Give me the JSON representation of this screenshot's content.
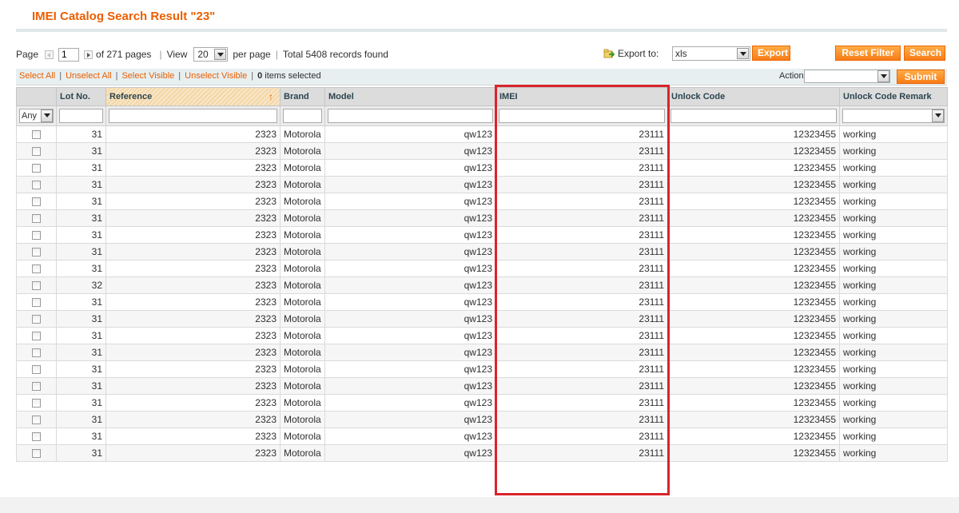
{
  "page": {
    "title": "IMEI Catalog Search Result  \"23\""
  },
  "pager": {
    "page_label": "Page",
    "current_page": "1",
    "of_pages": "of 271 pages",
    "view_label": "View",
    "per_page_value": "20",
    "per_page_label": "per page",
    "total_records": "Total 5408 records found",
    "export_label": "Export to:",
    "export_format": "xls",
    "export_button": "Export",
    "reset_filter_button": "Reset Filter",
    "search_button": "Search"
  },
  "massaction": {
    "select_all": "Select All",
    "unselect_all": "Unselect All",
    "select_visible": "Select Visible",
    "unselect_visible": "Unselect Visible",
    "selected_count": "0",
    "selected_suffix": "items selected",
    "actions_label": "Actions",
    "actions_value": "",
    "submit_button": "Submit"
  },
  "grid": {
    "columns": [
      "",
      "Lot No.",
      "Reference",
      "Brand",
      "Model",
      "IMEI",
      "Unlock Code",
      "Unlock Code Remark"
    ],
    "sorted_column": "Reference",
    "sort_direction_icon": "arrow-up-icon",
    "filter_any": "Any",
    "rows": [
      {
        "lot": "31",
        "reference": "2323",
        "brand": "Motorola",
        "model": "qw123",
        "imei": "23111",
        "unlock_code": "12323455",
        "remark": "working"
      },
      {
        "lot": "31",
        "reference": "2323",
        "brand": "Motorola",
        "model": "qw123",
        "imei": "23111",
        "unlock_code": "12323455",
        "remark": "working"
      },
      {
        "lot": "31",
        "reference": "2323",
        "brand": "Motorola",
        "model": "qw123",
        "imei": "23111",
        "unlock_code": "12323455",
        "remark": "working"
      },
      {
        "lot": "31",
        "reference": "2323",
        "brand": "Motorola",
        "model": "qw123",
        "imei": "23111",
        "unlock_code": "12323455",
        "remark": "working"
      },
      {
        "lot": "31",
        "reference": "2323",
        "brand": "Motorola",
        "model": "qw123",
        "imei": "23111",
        "unlock_code": "12323455",
        "remark": "working"
      },
      {
        "lot": "31",
        "reference": "2323",
        "brand": "Motorola",
        "model": "qw123",
        "imei": "23111",
        "unlock_code": "12323455",
        "remark": "working"
      },
      {
        "lot": "31",
        "reference": "2323",
        "brand": "Motorola",
        "model": "qw123",
        "imei": "23111",
        "unlock_code": "12323455",
        "remark": "working"
      },
      {
        "lot": "31",
        "reference": "2323",
        "brand": "Motorola",
        "model": "qw123",
        "imei": "23111",
        "unlock_code": "12323455",
        "remark": "working"
      },
      {
        "lot": "31",
        "reference": "2323",
        "brand": "Motorola",
        "model": "qw123",
        "imei": "23111",
        "unlock_code": "12323455",
        "remark": "working"
      },
      {
        "lot": "32",
        "reference": "2323",
        "brand": "Motorola",
        "model": "qw123",
        "imei": "23111",
        "unlock_code": "12323455",
        "remark": "working"
      },
      {
        "lot": "31",
        "reference": "2323",
        "brand": "Motorola",
        "model": "qw123",
        "imei": "23111",
        "unlock_code": "12323455",
        "remark": "working"
      },
      {
        "lot": "31",
        "reference": "2323",
        "brand": "Motorola",
        "model": "qw123",
        "imei": "23111",
        "unlock_code": "12323455",
        "remark": "working"
      },
      {
        "lot": "31",
        "reference": "2323",
        "brand": "Motorola",
        "model": "qw123",
        "imei": "23111",
        "unlock_code": "12323455",
        "remark": "working"
      },
      {
        "lot": "31",
        "reference": "2323",
        "brand": "Motorola",
        "model": "qw123",
        "imei": "23111",
        "unlock_code": "12323455",
        "remark": "working"
      },
      {
        "lot": "31",
        "reference": "2323",
        "brand": "Motorola",
        "model": "qw123",
        "imei": "23111",
        "unlock_code": "12323455",
        "remark": "working"
      },
      {
        "lot": "31",
        "reference": "2323",
        "brand": "Motorola",
        "model": "qw123",
        "imei": "23111",
        "unlock_code": "12323455",
        "remark": "working"
      },
      {
        "lot": "31",
        "reference": "2323",
        "brand": "Motorola",
        "model": "qw123",
        "imei": "23111",
        "unlock_code": "12323455",
        "remark": "working"
      },
      {
        "lot": "31",
        "reference": "2323",
        "brand": "Motorola",
        "model": "qw123",
        "imei": "23111",
        "unlock_code": "12323455",
        "remark": "working"
      },
      {
        "lot": "31",
        "reference": "2323",
        "brand": "Motorola",
        "model": "qw123",
        "imei": "23111",
        "unlock_code": "12323455",
        "remark": "working"
      },
      {
        "lot": "31",
        "reference": "2323",
        "brand": "Motorola",
        "model": "qw123",
        "imei": "23111",
        "unlock_code": "12323455",
        "remark": "working"
      }
    ]
  },
  "colors": {
    "accent": "#eb5e00",
    "button": "#f77c16",
    "highlight_box": "#d9242b",
    "header_bg": "#dcdcdc"
  }
}
